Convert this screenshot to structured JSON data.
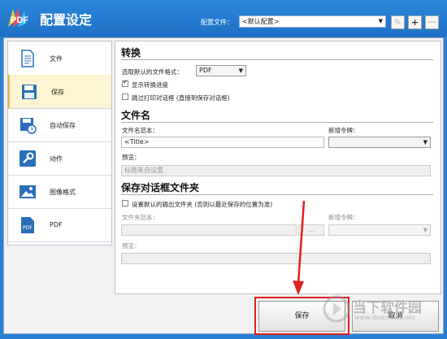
{
  "header": {
    "logo_text": "PDF",
    "title": "配置设定",
    "config_label": "配置文件：",
    "config_value": "<默认配置>",
    "edit_icon": "pencil-icon",
    "add_icon": "plus-icon",
    "more_icon": "ellipsis-icon"
  },
  "sidebar": {
    "items": [
      {
        "label": "文件",
        "icon": "document-icon",
        "active": false
      },
      {
        "label": "保存",
        "icon": "floppy-disk-icon",
        "active": true
      },
      {
        "label": "自动保存",
        "icon": "clock-document-icon",
        "active": false
      },
      {
        "label": "动作",
        "icon": "wrench-icon",
        "active": false
      },
      {
        "label": "图像格式",
        "icon": "image-icon",
        "active": false
      },
      {
        "label": "PDF",
        "icon": "pdf-file-icon",
        "active": false
      }
    ]
  },
  "convert": {
    "heading": "转换",
    "format_label": "选取默认的文件格式：",
    "format_value": "PDF",
    "show_progress_label": "显示转换进度",
    "show_progress_checked": true,
    "skip_print_label": "跳过打印对话框 (直接到保存对话框)",
    "skip_print_checked": false
  },
  "filename": {
    "heading": "文件名",
    "template_label": "文件名范本：",
    "template_value": "<Title>",
    "token_label": "新增令牌：",
    "token_value": "",
    "preview_label": "预览：",
    "preview_value": "标题来自设置"
  },
  "save_dialog": {
    "heading": "保存对话框文件夹",
    "default_dir_label": "设置默认的输出文件夹 (否则以最近保存的位置为准)",
    "default_dir_checked": false,
    "folder_template_label": "文件夹范本：",
    "browse_label": "...",
    "token_label": "新增令牌：",
    "preview_label": "预览："
  },
  "footer": {
    "save_label": "保存",
    "cancel_label": "取消"
  },
  "watermark": {
    "text": "当下软件园",
    "subtext": "www.downxia.com"
  },
  "colors": {
    "titlebar": "#2b86dc",
    "active_item": "#fcf4d2",
    "highlight": "#e02020"
  }
}
